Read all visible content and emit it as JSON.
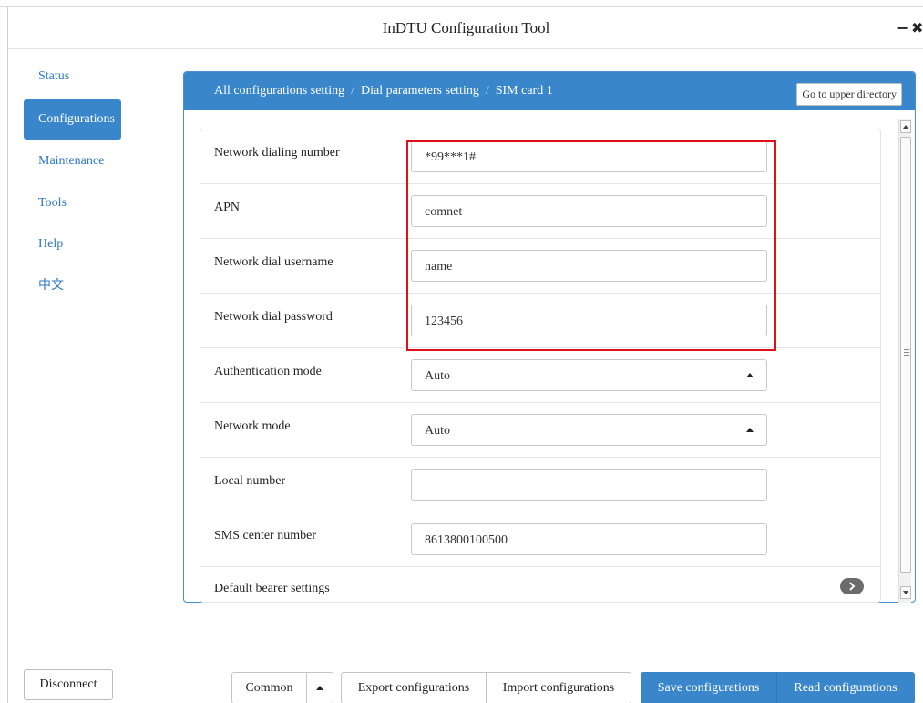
{
  "window": {
    "title": "InDTU Configuration Tool",
    "minimize_glyph": "−",
    "close_glyph": "✖"
  },
  "sidebar": {
    "items": [
      {
        "label": "Status",
        "active": false
      },
      {
        "label": "Configurations",
        "active": true
      },
      {
        "label": "Maintenance",
        "active": false
      },
      {
        "label": "Tools",
        "active": false
      },
      {
        "label": "Help",
        "active": false
      },
      {
        "label": "中文",
        "active": false
      }
    ],
    "disconnect_label": "Disconnect"
  },
  "breadcrumb": {
    "items": [
      "All configurations setting",
      "Dial parameters setting",
      "SIM card 1"
    ],
    "separator": "/",
    "upper_button": "Go to upper directory"
  },
  "form": {
    "rows": [
      {
        "label": "Network dialing number",
        "value": "*99***1#",
        "type": "text"
      },
      {
        "label": "APN",
        "value": "comnet",
        "type": "text"
      },
      {
        "label": "Network dial username",
        "value": "name",
        "type": "text"
      },
      {
        "label": "Network dial password",
        "value": "123456",
        "type": "text"
      },
      {
        "label": "Authentication mode",
        "value": "Auto",
        "type": "select"
      },
      {
        "label": "Network mode",
        "value": "Auto",
        "type": "select"
      },
      {
        "label": "Local number",
        "value": "",
        "type": "text"
      },
      {
        "label": "SMS center number",
        "value": "8613800100500",
        "type": "text"
      },
      {
        "label": "Default bearer settings",
        "value": "",
        "type": "expand"
      }
    ]
  },
  "toolbar": {
    "common_label": "Common",
    "export_label": "Export configurations",
    "import_label": "Import configurations",
    "save_label": "Save configurations",
    "read_label": "Read configurations"
  },
  "colors": {
    "accent": "#3a86cb",
    "link": "#2f78c8",
    "highlight": "#e0101a"
  }
}
